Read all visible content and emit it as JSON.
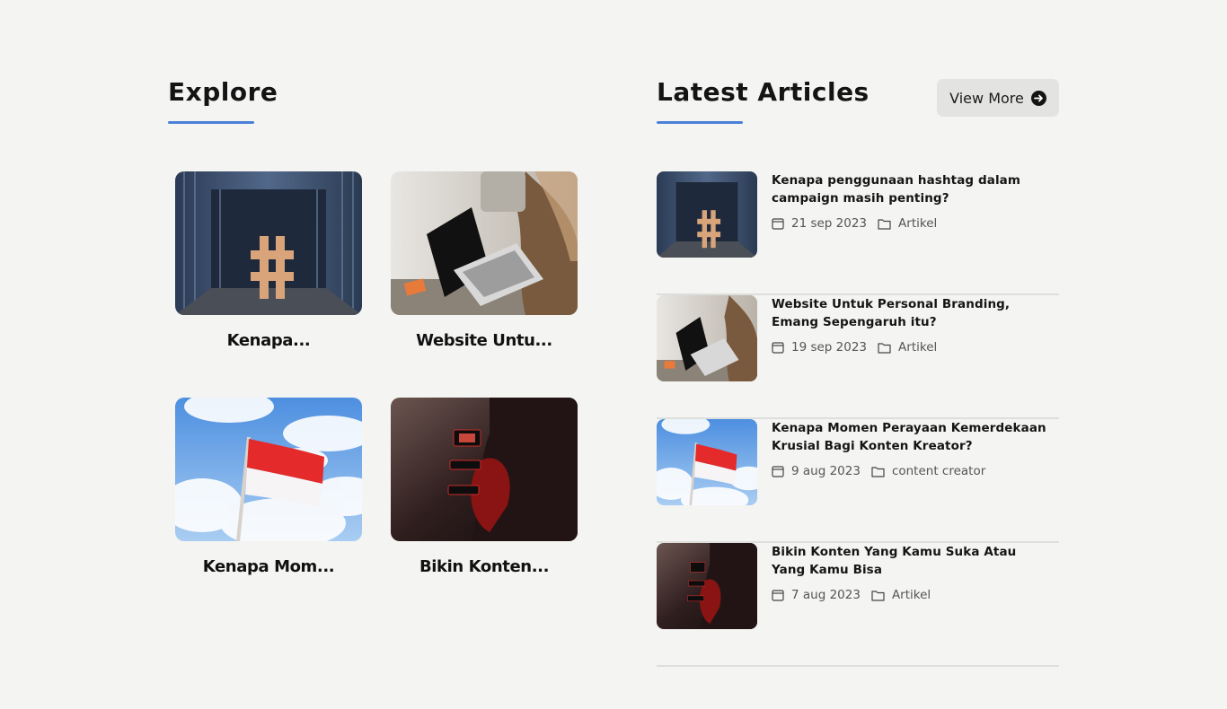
{
  "explore": {
    "title": "Explore",
    "cards": [
      {
        "title": "Kenapa...",
        "image": "hashtag-photo"
      },
      {
        "title": "Website Untu...",
        "image": "laptop-photo"
      },
      {
        "title": "Kenapa Mom...",
        "image": "flag-photo"
      },
      {
        "title": "Bikin Konten...",
        "image": "creator-photo"
      }
    ]
  },
  "latest": {
    "title": "Latest Articles",
    "view_more_label": "View More",
    "articles": [
      {
        "title": "Kenapa penggunaan hashtag dalam campaign masih penting?",
        "date": "21 sep 2023",
        "category": "Artikel",
        "image": "hashtag-photo"
      },
      {
        "title": "Website Untuk Personal Branding, Emang Sepengaruh itu?",
        "date": "19 sep 2023",
        "category": "Artikel",
        "image": "laptop-photo"
      },
      {
        "title": "Kenapa Momen Perayaan Kemerdekaan Krusial Bagi Konten Kreator?",
        "date": "9 aug 2023",
        "category": "content creator",
        "image": "flag-photo"
      },
      {
        "title": "Bikin Konten Yang Kamu Suka Atau Yang Kamu Bisa",
        "date": "7 aug 2023",
        "category": "Artikel",
        "image": "creator-photo"
      }
    ]
  },
  "colors": {
    "accent": "#4a80d8",
    "background": "#f4f4f2",
    "button": "#e3e3e1"
  }
}
